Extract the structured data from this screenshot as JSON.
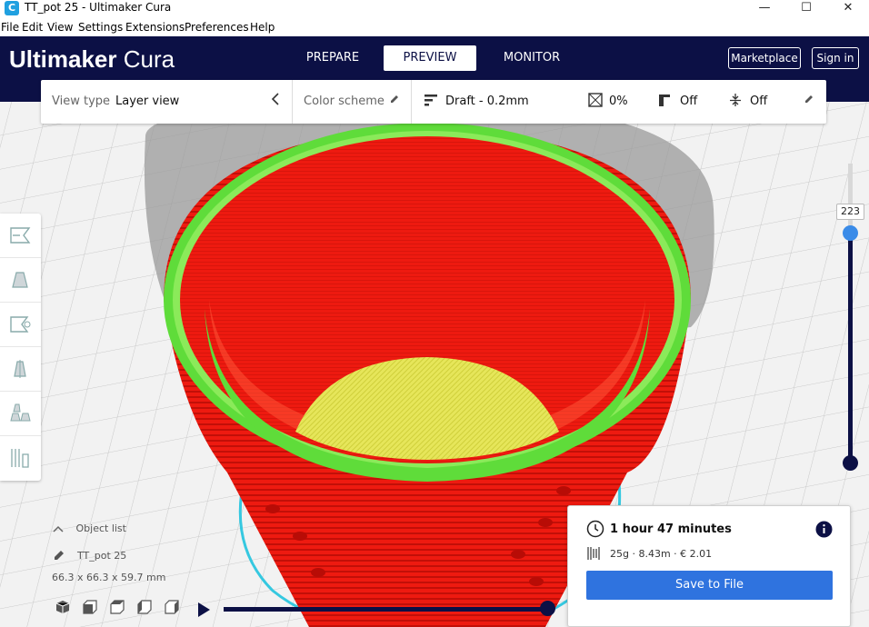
{
  "window": {
    "title": "TT_pot 25 - Ultimaker Cura",
    "app_icon": "C",
    "minimize": "—",
    "maximize": "☐",
    "close": "✕"
  },
  "menu": [
    "File",
    "Edit",
    "View",
    "Settings",
    "Extensions",
    "Preferences",
    "Help"
  ],
  "header": {
    "logo_bold": "Ultimaker",
    "logo_light": "Cura",
    "tabs": [
      "PREPARE",
      "PREVIEW",
      "MONITOR"
    ],
    "active_tab": "PREVIEW",
    "marketplace": "Marketplace",
    "sign_in": "Sign in"
  },
  "toolbar": {
    "view_type_label": "View type",
    "view_type_value": "Layer view",
    "color_scheme_label": "Color scheme",
    "profile": "Draft - 0.2mm",
    "infill": "0%",
    "support": "Off",
    "adhesion": "Off"
  },
  "layer_slider": {
    "current_layer": "223"
  },
  "object": {
    "list_label": "Object list",
    "name": "TT_pot 25",
    "dimensions": "66.3 x 66.3 x 59.7 mm"
  },
  "print_panel": {
    "time": "1 hour 47 minutes",
    "material": "25g · 8.43m · € 2.01",
    "save_button": "Save to File"
  },
  "colors": {
    "header_bg": "#0c1045",
    "accent_blue": "#2f73df",
    "wall_red": "#ee1a10",
    "skin_yellow": "#e6e65a",
    "inner_green": "#5fdc3a",
    "travel_cyan": "#35c8e0"
  },
  "icons": {
    "collapse": "chevron-left-icon",
    "edit": "pencil-icon",
    "profile": "profile-bars-icon",
    "infill": "infill-icon",
    "support": "support-icon",
    "adhesion": "adhesion-icon",
    "info": "info-icon",
    "clock": "clock-icon",
    "spool": "spool-icon",
    "play": "play-icon"
  }
}
